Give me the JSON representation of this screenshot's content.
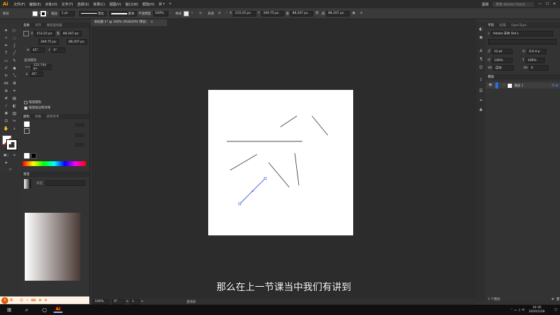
{
  "menubar": {
    "logo": "Ai",
    "items": [
      "文件(F)",
      "编辑(E)",
      "对象(O)",
      "文字(T)",
      "选择(S)",
      "效果(C)",
      "视图(V)",
      "窗口(W)",
      "帮助(H)"
    ],
    "right_label": "基础",
    "search_placeholder": "搜索 Adobe Stock"
  },
  "controlbar": {
    "path_label": "路径",
    "stroke_label": "描边",
    "stroke_value": "1 pt",
    "profile_label": "等比",
    "brush_label": "基本",
    "opacity_label": "不透明度",
    "opacity_value": "100%",
    "style_label": "样式",
    "shape_label": "形状",
    "x_label": "X",
    "x_value": "153.25 px",
    "y_label": "Y",
    "y_value": "349.75 px",
    "w_label": "宽",
    "w_value": "88.207 px",
    "h_label": "高",
    "h_value": "88.207 px"
  },
  "document": {
    "tab_title": "未标题-1* @ 100% (RGB/GPU 预览)",
    "close": "×"
  },
  "left_panel": {
    "transform_tabs": [
      "变换",
      "对齐",
      "路径查找器"
    ],
    "x_label": "X",
    "x_value": "153.25 px",
    "w_label": "宽",
    "w_value": "88.207 px",
    "y_value": "349.75 px",
    "h_value": "88.207 px",
    "angle_value": "45°",
    "shear_value": "0°",
    "line_props_title": "直线属性",
    "line_length": "123.744 px",
    "line_angle": "45°",
    "check1": "缩放圆角",
    "check2": "缩放描边和效果",
    "color_tabs": [
      "颜色",
      "色板",
      "颜色参考"
    ],
    "gradient_title": "渐变",
    "gradient_type": "类型"
  },
  "right_panel": {
    "char_tabs": [
      "字符",
      "段落",
      "OpenType"
    ],
    "font_family": "Adobe 宋体 Std L",
    "font_size": "12 pt",
    "leading": "(14.4 p",
    "scale_h": "100%",
    "scale_v": "100%",
    "tracking": "自动",
    "kerning": "0",
    "layers_title": "图层",
    "layer_name": "图层 1",
    "layers_count": "1 个图层"
  },
  "statusbar": {
    "zoom": "100%",
    "angle": "0°",
    "artboard_num": "1",
    "tool_name": "直线段"
  },
  "subtitle": "那么在上一节课当中我们有讲到",
  "sogou": {
    "label": "英"
  },
  "taskbar": {
    "time": "16:30",
    "date": "2020/2/28"
  },
  "colors": {
    "accent": "#2d6ee0",
    "selection": "#3d5bd8",
    "app_orange": "#ff9a00"
  }
}
